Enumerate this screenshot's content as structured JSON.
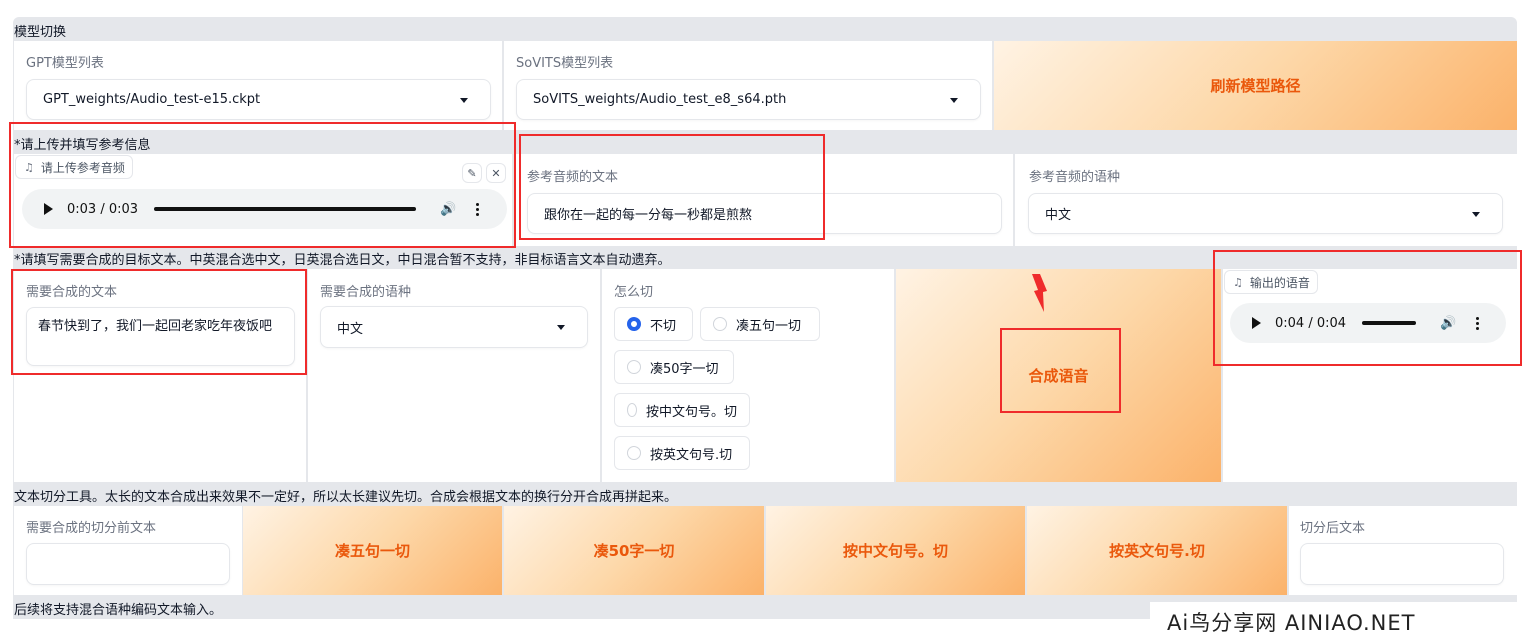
{
  "model_switch": {
    "title": "模型切换",
    "gpt": {
      "label": "GPT模型列表",
      "value": "GPT_weights/Audio_test-e15.ckpt"
    },
    "sovits": {
      "label": "SoVITS模型列表",
      "value": "SoVITS_weights/Audio_test_e8_s64.pth"
    },
    "refresh_label": "刷新模型路径"
  },
  "reference": {
    "title": "*请上传并填写参考信息",
    "audio_tag": "请上传参考音频",
    "audio_time": "0:03 / 0:03",
    "text_label": "参考音频的文本",
    "text_value": "跟你在一起的每一分每一秒都是煎熬",
    "lang_label": "参考音频的语种",
    "lang_value": "中文"
  },
  "target": {
    "title": "*请填写需要合成的目标文本。中英混合选中文，日英混合选日文，中日混合暂不支持，非目标语言文本自动遗弃。",
    "text_label": "需要合成的文本",
    "text_value": "春节快到了，我们一起回老家吃年夜饭吧",
    "lang_label": "需要合成的语种",
    "lang_value": "中文",
    "cut_label": "怎么切",
    "cut_options": [
      "不切",
      "凑五句一切",
      "凑50字一切",
      "按中文句号。切",
      "按英文句号.切"
    ],
    "synth_label": "合成语音",
    "output_tag": "输出的语音",
    "output_time": "0:04 / 0:04"
  },
  "split_tool": {
    "title": "文本切分工具。太长的文本合成出来效果不一定好，所以太长建议先切。合成会根据文本的换行分开合成再拼起来。",
    "before_label": "需要合成的切分前文本",
    "btn1": "凑五句一切",
    "btn2": "凑50字一切",
    "btn3": "按中文句号。切",
    "btn4": "按英文句号.切",
    "after_label": "切分后文本"
  },
  "footer_note": "后续将支持混合语种编码文本输入。",
  "watermark": "Ai鸟分享网  AINIAO.NET"
}
